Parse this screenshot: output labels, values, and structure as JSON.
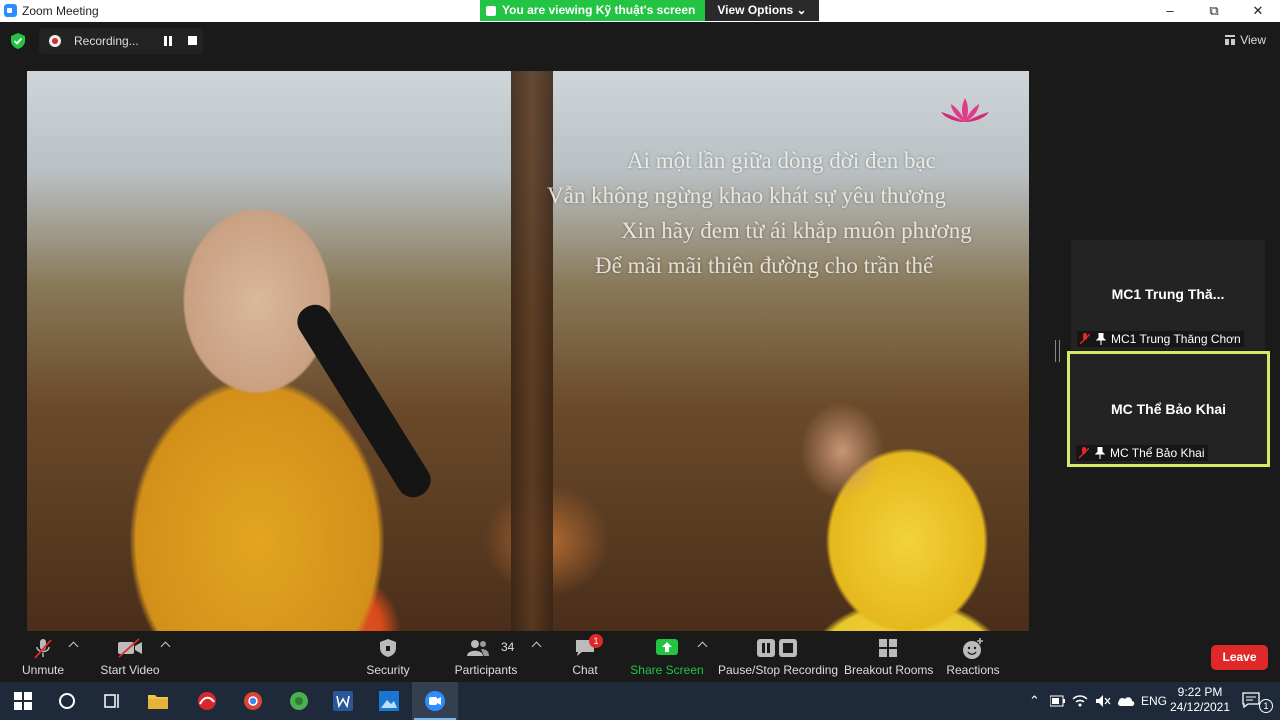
{
  "window": {
    "title": "Zoom Meeting",
    "controls": {
      "minimize": "–",
      "restore": "⧉",
      "close": "✕"
    }
  },
  "share_banner": {
    "viewing": "You are viewing Kỹ thuật's screen",
    "view_options": "View Options ⌄"
  },
  "topbar": {
    "recording_label": "Recording...",
    "view_label": "View"
  },
  "shared_content": {
    "lyrics": [
      "Ai một lần giữa dòng đời đen bạc",
      "Vẫn không ngừng khao khát sự yêu thương",
      "Xin hãy đem từ ái khắp muôn phương",
      "Để mãi mãi thiên đường cho trần thế"
    ]
  },
  "participants": [
    {
      "display_name": "MC1  Trung Thă...",
      "label": "MC1 Trung Thăng Chơn",
      "active": false
    },
    {
      "display_name": "MC Thể Bảo Khai",
      "label": "MC Thể Bảo Khai",
      "active": true
    }
  ],
  "toolbar": {
    "unmute": "Unmute",
    "start_video": "Start Video",
    "security": "Security",
    "participants": "Participants",
    "participants_count": "34",
    "chat": "Chat",
    "chat_badge": "1",
    "share_screen": "Share Screen",
    "pause_stop_recording": "Pause/Stop Recording",
    "breakout_rooms": "Breakout Rooms",
    "reactions": "Reactions",
    "leave": "Leave"
  },
  "taskbar": {
    "language": "ENG",
    "time": "9:22 PM",
    "date": "24/12/2021",
    "notification_count": "1"
  },
  "colors": {
    "share_green": "#23c343",
    "leave_red": "#e02828",
    "active_tile_border": "#d8e86a",
    "zoom_blue": "#2d8cff"
  }
}
